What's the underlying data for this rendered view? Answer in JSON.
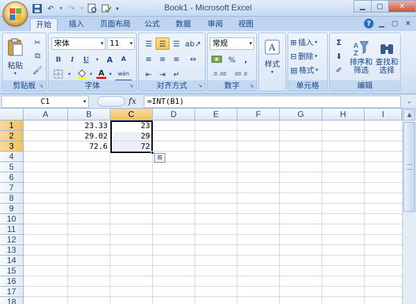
{
  "window": {
    "title": "Book1 - Microsoft Excel"
  },
  "tabs": [
    "开始",
    "插入",
    "页面布局",
    "公式",
    "数据",
    "审阅",
    "视图"
  ],
  "ribbon": {
    "clipboard": {
      "paste": "粘贴",
      "label": "剪贴板"
    },
    "font": {
      "name": "宋体",
      "size": "11",
      "bold": "B",
      "italic": "I",
      "underline": "U",
      "grow": "A",
      "shrink": "A",
      "color": "A",
      "phonetic": "wén",
      "label": "字体"
    },
    "alignment": {
      "label": "对齐方式"
    },
    "number": {
      "format": "常规",
      "percent": "%",
      "comma": ",",
      "inc_dec": ".0 .00",
      "dec_dec": ".00 .0",
      "label": "数字"
    },
    "styles": {
      "label": "样式"
    },
    "cells": {
      "insert": "插入",
      "delete": "删除",
      "format": "格式",
      "label": "单元格"
    },
    "editing": {
      "sum": "Σ",
      "sort": "排序和\n筛选",
      "find": "查找和\n选择",
      "label": "编辑"
    }
  },
  "formula_bar": {
    "name_box": "C1",
    "fx": "fx",
    "formula": "=INT(B1)"
  },
  "sheet": {
    "columns": [
      "A",
      "B",
      "C",
      "D",
      "E",
      "F",
      "G",
      "H",
      "I"
    ],
    "rows": [
      "1",
      "2",
      "3",
      "4",
      "5",
      "6",
      "7",
      "8",
      "9",
      "10",
      "11",
      "12",
      "13",
      "14",
      "15",
      "16",
      "17",
      "18"
    ],
    "selected_column": "C",
    "cells": {
      "B1": "23.33",
      "C1": "23",
      "B2": "29.02",
      "C2": "29",
      "B3": "72.6",
      "C3": "72"
    }
  }
}
